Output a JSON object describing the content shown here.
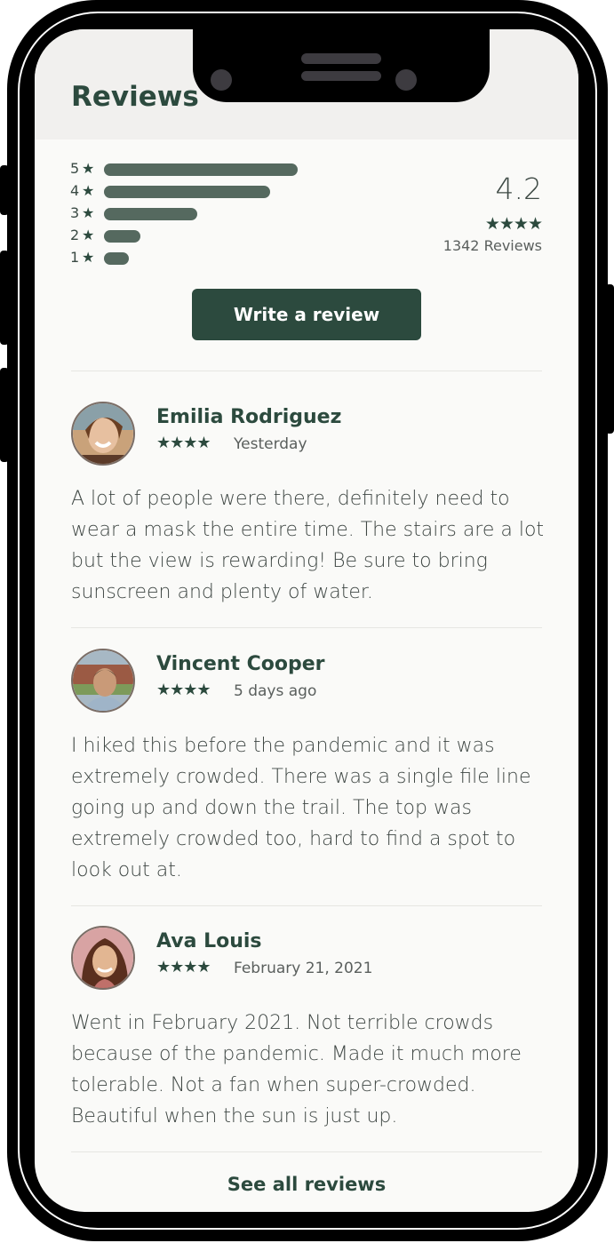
{
  "header": {
    "title": "Reviews"
  },
  "rating_summary": {
    "distribution": [
      {
        "stars": "5",
        "share": 1.0
      },
      {
        "stars": "4",
        "share": 0.86
      },
      {
        "stars": "3",
        "share": 0.48
      },
      {
        "stars": "2",
        "share": 0.19
      },
      {
        "stars": "1",
        "share": 0.13
      }
    ],
    "star_glyph": "★",
    "average": "4.2",
    "average_stars": "★★★★",
    "count_label": "1342 Reviews"
  },
  "actions": {
    "write_review": "Write a review",
    "see_all": "See all reviews"
  },
  "reviews": [
    {
      "name": "Emilia Rodriguez",
      "stars": "★★★★",
      "rating": 4,
      "date": "Yesterday",
      "avatar": "avatar-photo",
      "text": "A lot of people were there, definitely need to wear a mask the entire time. The stairs are a lot but the view is rewarding! Be sure to bring sunscreen and plenty of water."
    },
    {
      "name": "Vincent Cooper",
      "stars": "★★★★",
      "rating": 4,
      "date": "5 days ago",
      "avatar": "avatar-photo",
      "text": "I hiked this before the pandemic and it was extremely crowded. There was a single file line going up and down the trail. The top was extremely crowded too, hard to find a spot to look out at."
    },
    {
      "name": "Ava Louis",
      "stars": "★★★★",
      "rating": 4,
      "date": "February 21, 2021",
      "avatar": "avatar-photo",
      "text": "Went in February 2021. Not terrible crowds because of the pandemic. Made it much more tolerable. Not a fan when super-crowded. Beautiful when the sun is just up."
    }
  ],
  "colors": {
    "accent": "#2c4a3e",
    "bar": "#55695f",
    "header_bg": "#f1f0ee",
    "screen_bg": "#fafaf8"
  }
}
